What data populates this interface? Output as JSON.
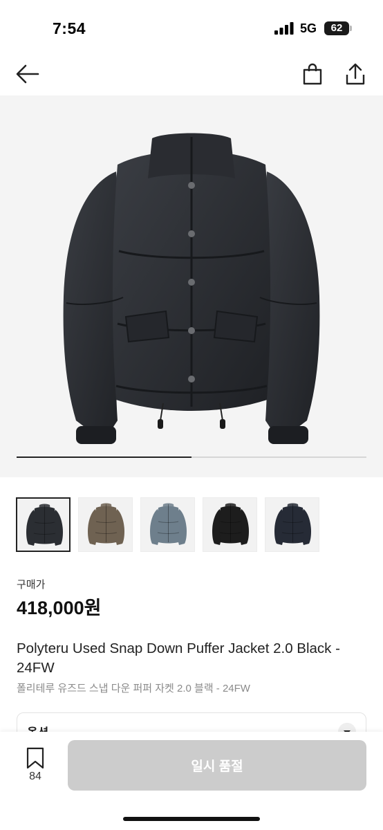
{
  "status_bar": {
    "time": "7:54",
    "network": "5G",
    "battery": "62"
  },
  "gallery": {
    "progress": 0.5,
    "thumbnails": [
      {
        "color": "#2b2e33",
        "active": true
      },
      {
        "color": "#6f6252",
        "active": false
      },
      {
        "color": "#6e7f8c",
        "active": false
      },
      {
        "color": "#1d1d1d",
        "active": false
      },
      {
        "color": "#262b36",
        "active": false
      }
    ]
  },
  "price": {
    "label": "구매가",
    "value": "418,000원"
  },
  "product": {
    "title_en": "Polyteru Used Snap Down Puffer Jacket 2.0 Black - 24FW",
    "title_ko": "폴리테루 유즈드 스냅 다운 퍼퍼 자켓 2.0 블랙 - 24FW"
  },
  "option": {
    "label": "옵션"
  },
  "bottom": {
    "wish_count": "84",
    "buy_label": "일시 품절"
  },
  "colors": {
    "jacket": "#2b2e33",
    "button_disabled": "#cccccc"
  }
}
